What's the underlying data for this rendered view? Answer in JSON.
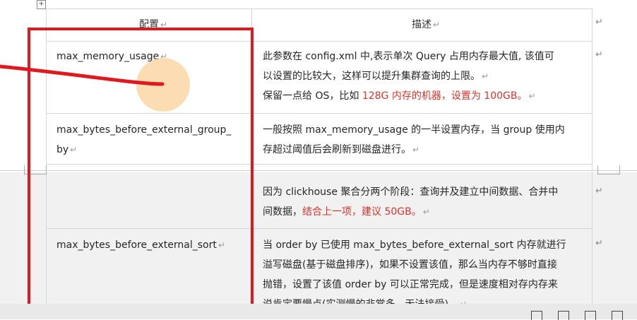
{
  "table": {
    "header": {
      "col1": "配置",
      "col2": "描述"
    },
    "rows": [
      {
        "config": "max_memory_usage",
        "desc_lines": [
          "此参数在 config.xml 中,表示单次 Query 占用内存最大值, 该值可",
          "以设置的比较大，这样可以提升集群查询的上限。"
        ],
        "desc_line3_plain": "保留一点给 OS，比如 ",
        "desc_line3_red": "128G 内存的机器，设置为 100GB。"
      },
      {
        "config_lines": [
          "max_bytes_before_external_group_",
          "by"
        ],
        "desc_lines": [
          "一般按照 max_memory_usage 的一半设置内存，当 group 使用内",
          "存超过阈值后会刷新到磁盘进行。"
        ]
      },
      {
        "config": "",
        "desc_line1": "因为 clickhouse 聚合分两个阶段：查询并及建立中间数据、合并中",
        "desc_line2_plain": "间数据，",
        "desc_line2_red": "结合上一项，建议 50GB。"
      },
      {
        "config": "max_bytes_before_external_sort",
        "desc_lines": [
          "当 order  by 已使用 max_bytes_before_external_sort 内存就进行",
          "溢写磁盘(基于磁盘排序)，如果不设置该值，那么当内存不够时直接",
          "抛错，设置了该值 order  by 可以正常完成，但是速度相对存内存来",
          "说肯定要慢点(实测慢的非常多，无法接受)。"
        ]
      }
    ]
  },
  "marks": {
    "para": "↵",
    "table_anchor": "+"
  },
  "colors": {
    "annotation_red": "#e0191f",
    "text_red": "#d9342b",
    "highlight": "#fbcd92"
  }
}
